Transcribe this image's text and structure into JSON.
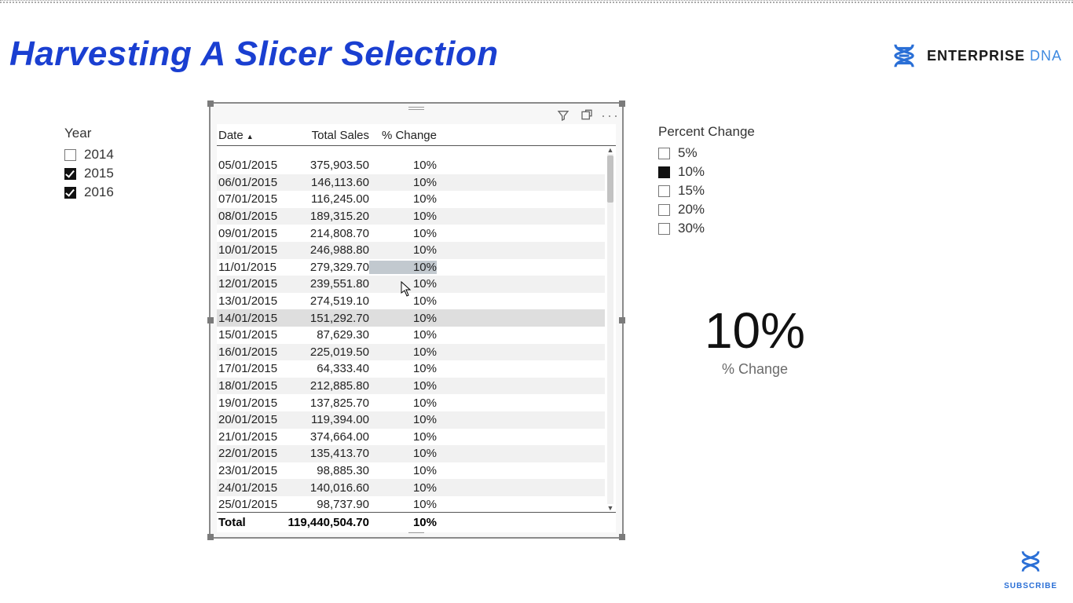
{
  "title": "Harvesting A Slicer Selection",
  "logo": {
    "text_primary": "ENTERPRISE",
    "text_secondary": "DNA"
  },
  "year_slicer": {
    "title": "Year",
    "items": [
      {
        "label": "2014",
        "checked": false
      },
      {
        "label": "2015",
        "checked": true
      },
      {
        "label": "2016",
        "checked": true
      }
    ]
  },
  "pct_slicer": {
    "title": "Percent Change",
    "items": [
      {
        "label": "5%",
        "selected": false
      },
      {
        "label": "10%",
        "selected": true
      },
      {
        "label": "15%",
        "selected": false
      },
      {
        "label": "20%",
        "selected": false
      },
      {
        "label": "30%",
        "selected": false
      }
    ]
  },
  "table": {
    "columns": [
      "Date",
      "Total Sales",
      "% Change"
    ],
    "rows": [
      {
        "date": "05/01/2015",
        "sales": "375,903.50",
        "chg": "10%"
      },
      {
        "date": "06/01/2015",
        "sales": "146,113.60",
        "chg": "10%"
      },
      {
        "date": "07/01/2015",
        "sales": "116,245.00",
        "chg": "10%"
      },
      {
        "date": "08/01/2015",
        "sales": "189,315.20",
        "chg": "10%"
      },
      {
        "date": "09/01/2015",
        "sales": "214,808.70",
        "chg": "10%"
      },
      {
        "date": "10/01/2015",
        "sales": "246,988.80",
        "chg": "10%"
      },
      {
        "date": "11/01/2015",
        "sales": "279,329.70",
        "chg": "10%",
        "highlight": true
      },
      {
        "date": "12/01/2015",
        "sales": "239,551.80",
        "chg": "10%"
      },
      {
        "date": "13/01/2015",
        "sales": "274,519.10",
        "chg": "10%"
      },
      {
        "date": "14/01/2015",
        "sales": "151,292.70",
        "chg": "10%",
        "selected": true
      },
      {
        "date": "15/01/2015",
        "sales": "87,629.30",
        "chg": "10%"
      },
      {
        "date": "16/01/2015",
        "sales": "225,019.50",
        "chg": "10%"
      },
      {
        "date": "17/01/2015",
        "sales": "64,333.40",
        "chg": "10%"
      },
      {
        "date": "18/01/2015",
        "sales": "212,885.80",
        "chg": "10%"
      },
      {
        "date": "19/01/2015",
        "sales": "137,825.70",
        "chg": "10%"
      },
      {
        "date": "20/01/2015",
        "sales": "119,394.00",
        "chg": "10%"
      },
      {
        "date": "21/01/2015",
        "sales": "374,664.00",
        "chg": "10%"
      },
      {
        "date": "22/01/2015",
        "sales": "135,413.70",
        "chg": "10%"
      },
      {
        "date": "23/01/2015",
        "sales": "98,885.30",
        "chg": "10%"
      },
      {
        "date": "24/01/2015",
        "sales": "140,016.60",
        "chg": "10%"
      },
      {
        "date": "25/01/2015",
        "sales": "98,737.90",
        "chg": "10%"
      }
    ],
    "total": {
      "label": "Total",
      "sales": "119,440,504.70",
      "chg": "10%"
    }
  },
  "card": {
    "value": "10%",
    "label": "% Change"
  },
  "subscribe": {
    "label": "SUBSCRIBE"
  }
}
